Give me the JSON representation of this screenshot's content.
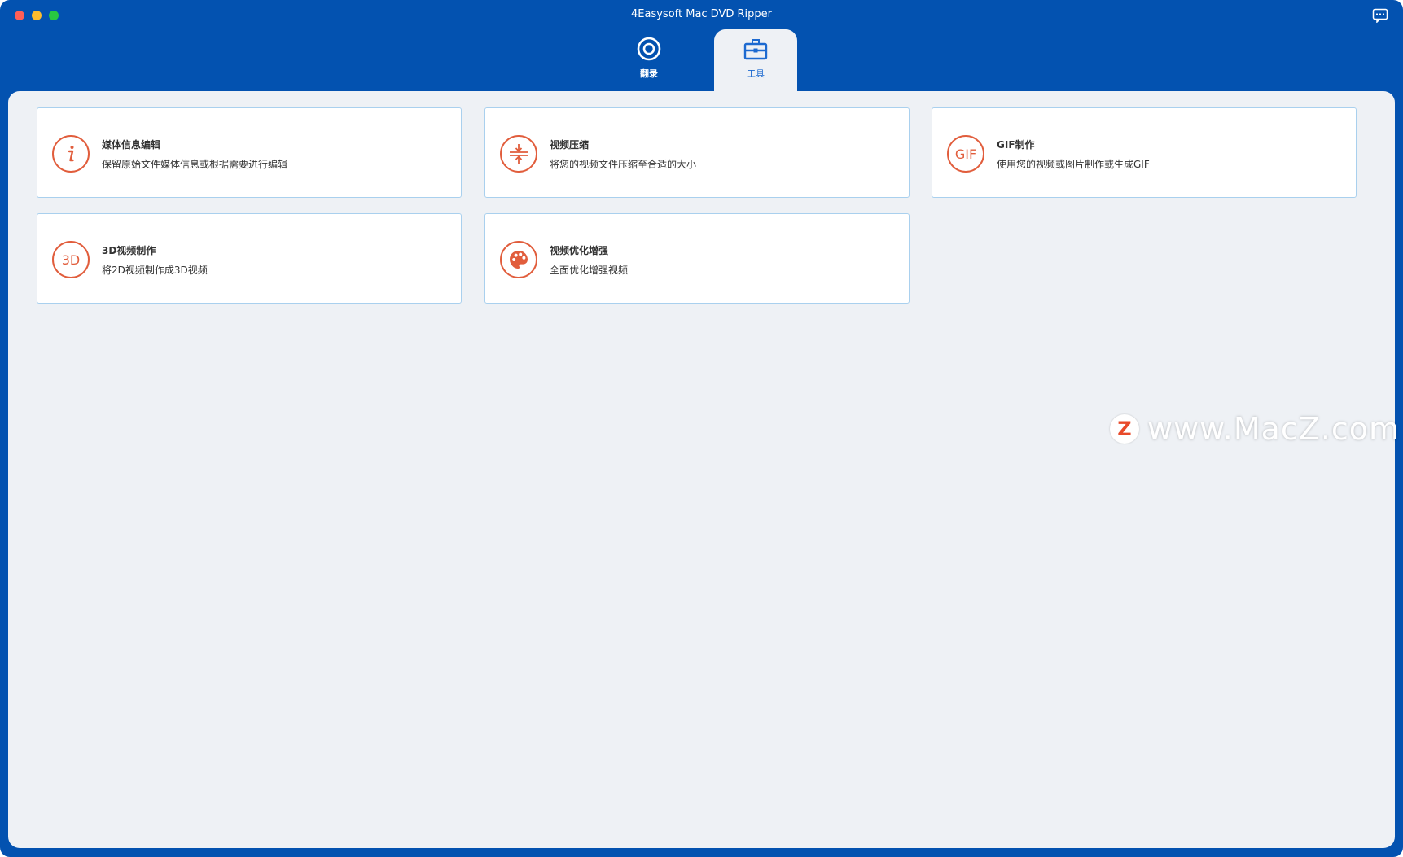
{
  "window": {
    "title": "4Easysoft Mac DVD Ripper"
  },
  "tabs": [
    {
      "label": "翻录",
      "icon": "disc-icon"
    },
    {
      "label": "工具",
      "icon": "toolbox-icon"
    }
  ],
  "tools": [
    {
      "title": "媒体信息编辑",
      "desc": "保留原始文件媒体信息或根据需要进行编辑",
      "icon": "info-icon"
    },
    {
      "title": "视频压缩",
      "desc": "将您的视频文件压缩至合适的大小",
      "icon": "compress-icon"
    },
    {
      "title": "GIF制作",
      "desc": "使用您的视频或图片制作或生成GIF",
      "icon": "gif-icon",
      "icon_text": "GIF"
    },
    {
      "title": "3D视频制作",
      "desc": "将2D视频制作成3D视频",
      "icon": "3d-icon",
      "icon_text": "3D"
    },
    {
      "title": "视频优化增强",
      "desc": "全面优化增强视频",
      "icon": "palette-icon"
    }
  ],
  "watermark": {
    "badge": "Z",
    "text": "www.MacZ.com"
  },
  "colors": {
    "titlebar": "#0352b0",
    "panel": "#eef1f5",
    "accent": "#e15d3c",
    "active_tab": "#1d6ad0"
  }
}
